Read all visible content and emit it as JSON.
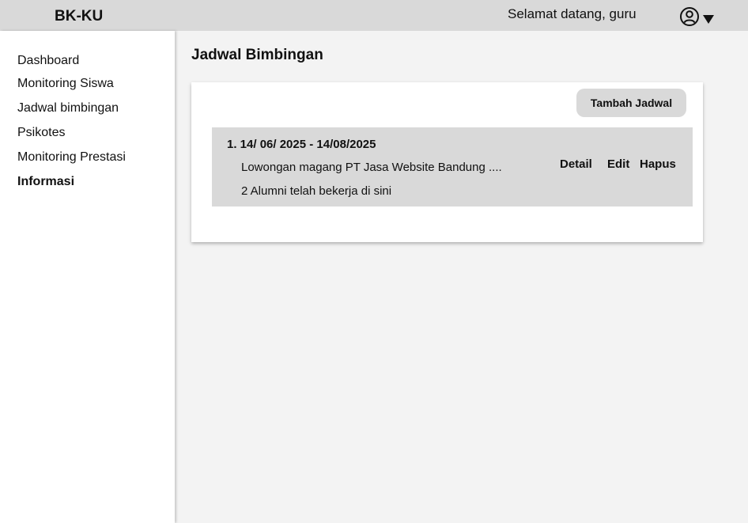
{
  "header": {
    "brand": "BK-KU",
    "welcome": "Selamat datang, guru"
  },
  "sidebar": {
    "items": [
      {
        "label": "Dashboard",
        "active": false
      },
      {
        "label": "Monitoring Siswa",
        "active": false
      },
      {
        "label": "Jadwal bimbingan",
        "active": false
      },
      {
        "label": "Psikotes",
        "active": false
      },
      {
        "label": "Monitoring Prestasi",
        "active": false
      },
      {
        "label": "Informasi",
        "active": true
      }
    ]
  },
  "main": {
    "title": "Jadwal Bimbingan",
    "add_button": "Tambah Jadwal",
    "schedules": [
      {
        "date": "1. 14/ 06/ 2025 - 14/08/2025",
        "description": "Lowongan magang PT Jasa Website Bandung ....",
        "note": "2 Alumni telah bekerja di sini",
        "actions": {
          "detail": "Detail",
          "edit": "Edit",
          "delete": "Hapus"
        }
      }
    ]
  },
  "colors": {
    "topbar": "#d9d9d9",
    "background": "#f3f3f3",
    "card": "#ffffff",
    "row": "#d9d9d9"
  }
}
